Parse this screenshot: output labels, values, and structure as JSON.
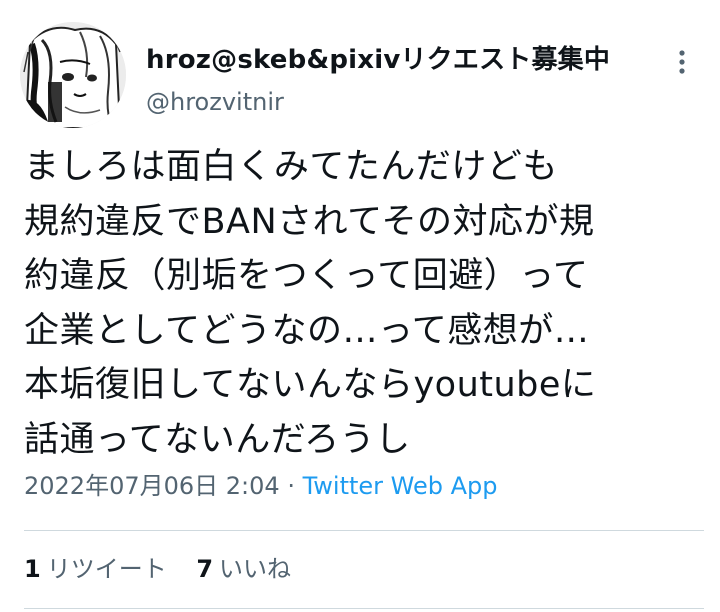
{
  "tweet": {
    "display_name": "hroz@skeb&pixivリクエスト募集中",
    "handle": "@hrozvitnir",
    "text": "ましろは面白くみてたんだけども\n規約違反でBANされてその対応が規\n約違反（別垢をつくって回避）って\n企業としてどうなの…って感想が…\n本垢復旧してないんならyoutubeに\n話通ってないんだろうし",
    "date": "2022年07月06日 2:04",
    "separator": "·",
    "app": "Twitter Web App",
    "retweets": {
      "count": "1",
      "label": "リツイート"
    },
    "likes": {
      "count": "7",
      "label": "いいね"
    }
  },
  "icons": {
    "more": "more-vertical-icon",
    "avatar": "manga-style-avatar"
  },
  "colors": {
    "text": "#0f1419",
    "secondary": "#536471",
    "link": "#1d9bf0",
    "divider": "#cfd9de"
  }
}
